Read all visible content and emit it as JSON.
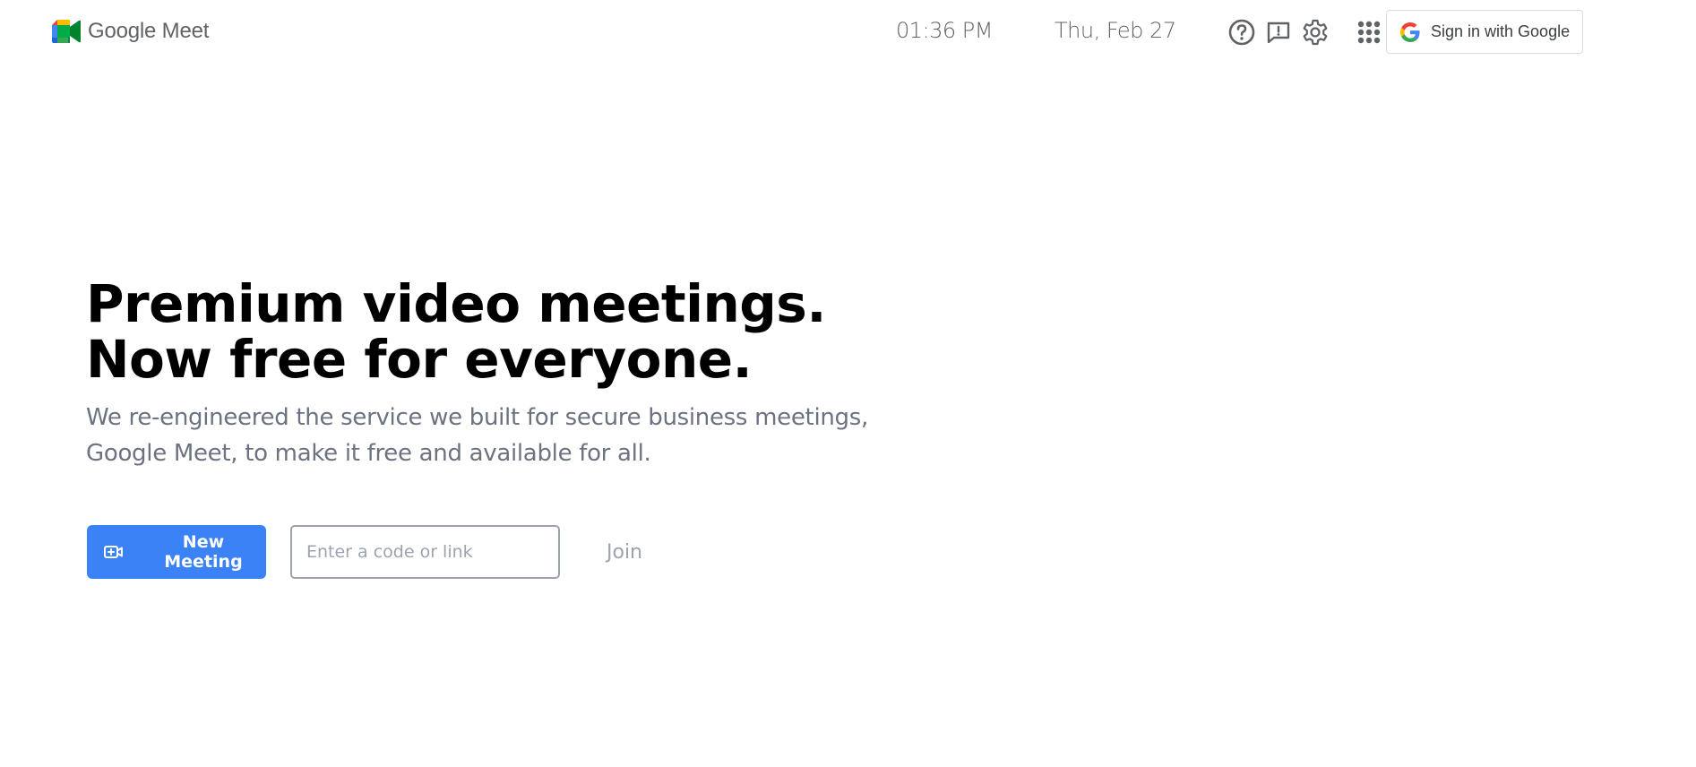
{
  "header": {
    "app_name": "Google Meet",
    "time": "01:36 PM",
    "date": "Thu, Feb 27",
    "icons": [
      "help-icon",
      "feedback-icon",
      "settings-icon",
      "apps-grid-icon"
    ],
    "signin_label": "Sign in with Google"
  },
  "hero": {
    "title": "Premium video meetings. Now free for everyone.",
    "subtitle": "We re-engineered the service we built for secure business meetings, Google Meet, to make it free and available for all."
  },
  "actions": {
    "new_meeting_label": "New Meeting",
    "code_placeholder": "Enter a code or link",
    "code_value": "",
    "join_label": "Join"
  },
  "colors": {
    "primary": "#3b82f6",
    "muted_text": "#6b7280",
    "icon_gray": "#5f6368"
  }
}
